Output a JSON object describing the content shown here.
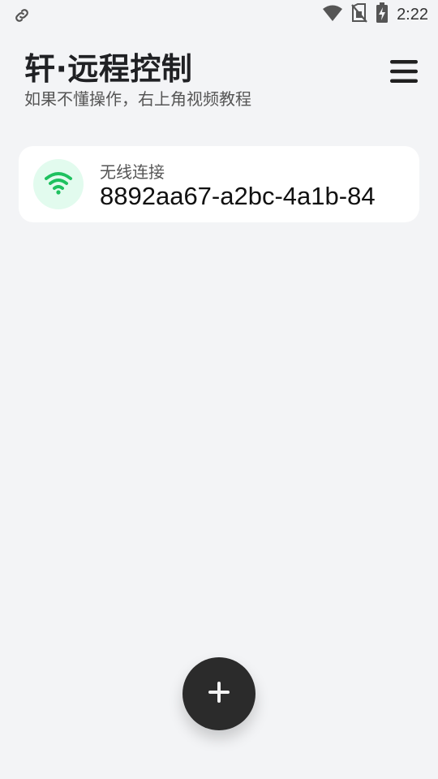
{
  "status_bar": {
    "time": "2:22",
    "icons": [
      "link-icon",
      "wifi-signal-icon",
      "no-sim-icon",
      "battery-charging-icon"
    ]
  },
  "header": {
    "title": "轩·远程控制",
    "subtitle": "如果不懂操作，右上角视频教程",
    "menu_icon": "hamburger-menu-icon"
  },
  "devices": [
    {
      "type_label": "无线连接",
      "device_id": "8892aa67-a2bc-4a1b-84",
      "icon": "wifi-icon",
      "icon_color": "#1ec15f",
      "icon_bg": "#e2fbee"
    }
  ],
  "fab": {
    "icon": "plus-icon"
  },
  "colors": {
    "background": "#f3f4f6",
    "card": "#ffffff",
    "fab": "#2b2b2b",
    "accent_green": "#1ec15f"
  }
}
